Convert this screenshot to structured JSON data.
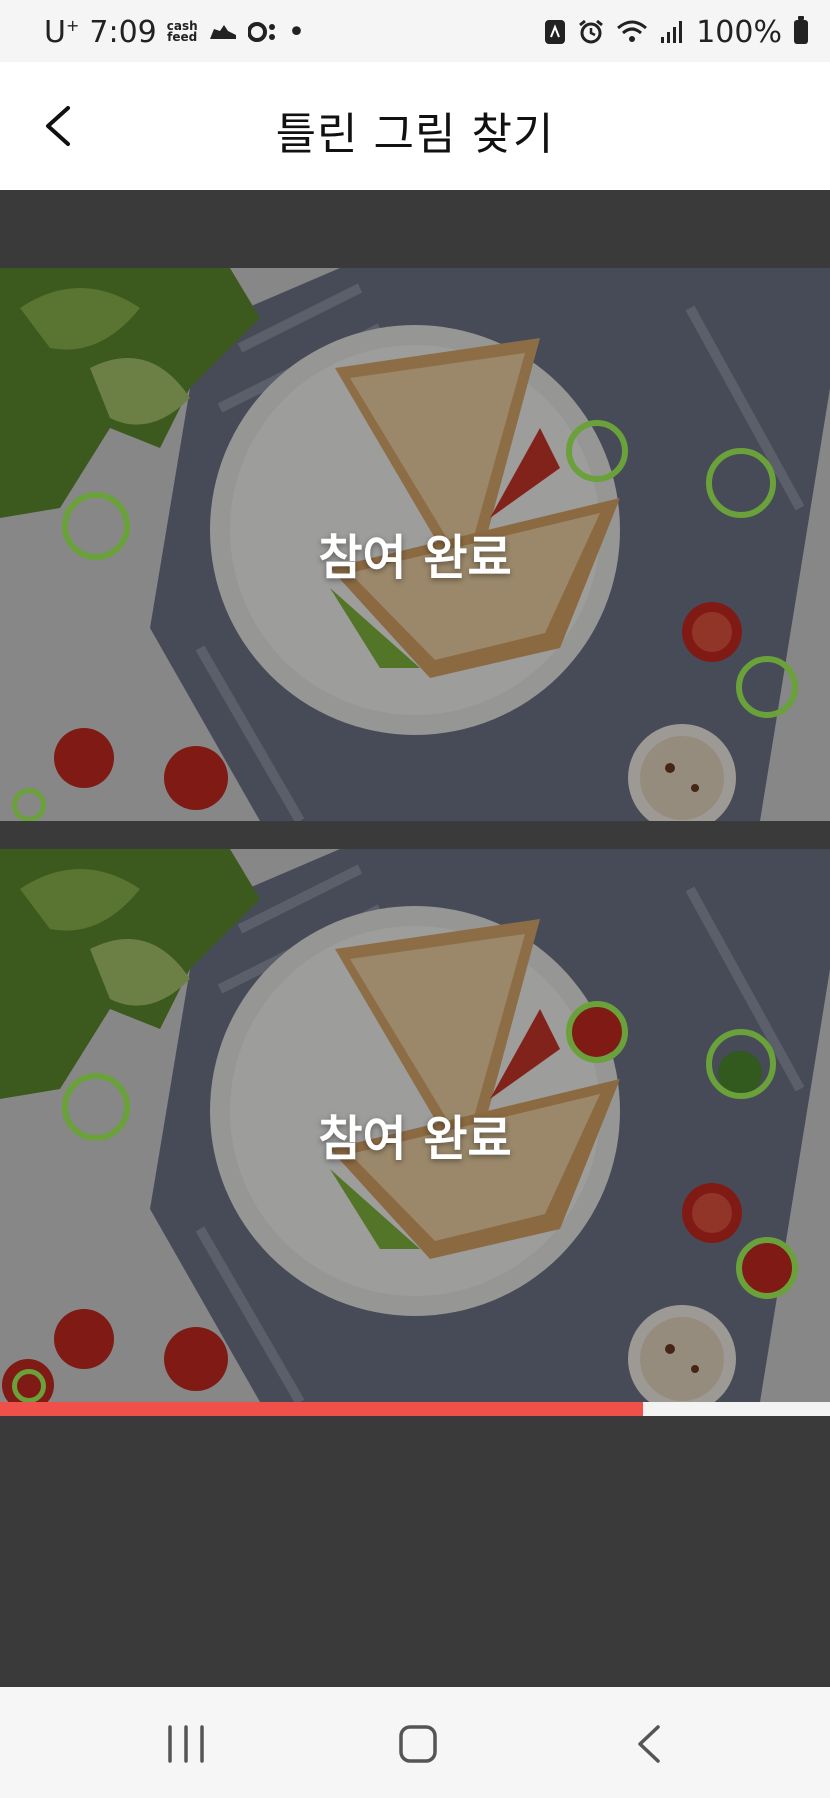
{
  "status_bar": {
    "carrier": "U",
    "carrier_sup": "+",
    "time": "7:09",
    "cashfeed_line1": "cash",
    "cashfeed_line2": "feed",
    "dot": "•",
    "battery_text": "100%"
  },
  "header": {
    "title": "틀린 그림 찾기"
  },
  "game": {
    "completed_label": "참여 완료",
    "marker_color": "#6aa13a",
    "timer_progress": 0.775,
    "timer_color": "#f0504a"
  }
}
